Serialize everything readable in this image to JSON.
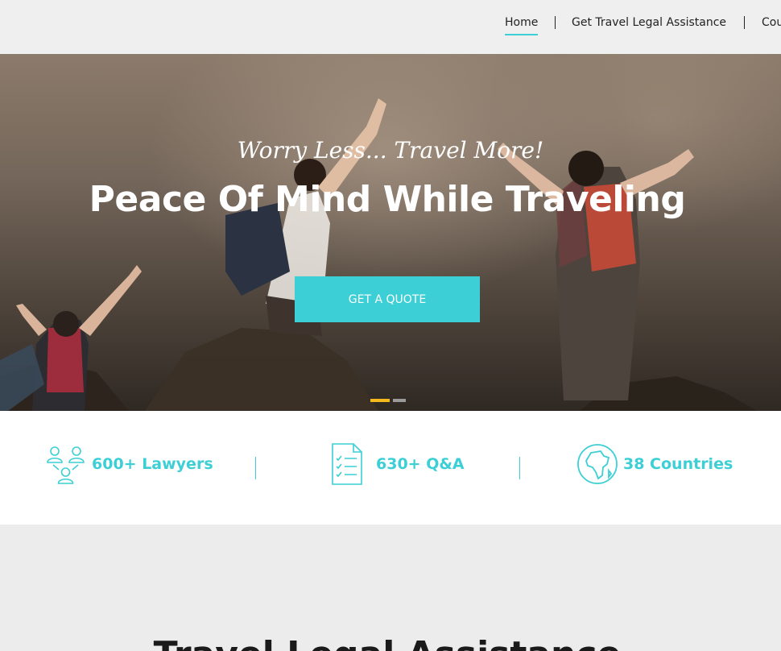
{
  "nav": {
    "home": "Home",
    "assistance": "Get Travel Legal Assistance",
    "countries": "Cou"
  },
  "hero": {
    "tagline": "Worry Less... Travel More!",
    "title": "Peace Of Mind While Traveling",
    "cta": "GET A QUOTE",
    "slides": 2,
    "active_slide": 1
  },
  "stats": [
    {
      "label": "600+ Lawyers",
      "icon": "lawyers-icon"
    },
    {
      "label": "630+ Q&A",
      "icon": "checklist-document-icon"
    },
    {
      "label": "38 Countries",
      "icon": "globe-icon"
    }
  ],
  "section": {
    "title": "Travel Legal Assistance"
  },
  "colors": {
    "accent": "#3ccfd5",
    "slider_active": "#f6b91b",
    "header_bg": "#efefef"
  }
}
